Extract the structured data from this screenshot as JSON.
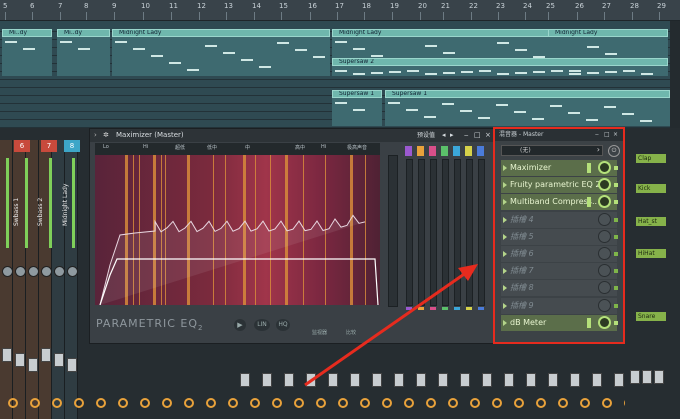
{
  "ruler": {
    "bars": [
      "5",
      "6",
      "7",
      "8",
      "9",
      "10",
      "11",
      "12",
      "13",
      "14",
      "15",
      "16",
      "17",
      "18",
      "19",
      "20",
      "21",
      "22",
      "23",
      "24",
      "25",
      "26",
      "27",
      "28",
      "29"
    ]
  },
  "playlist": {
    "clips": [
      {
        "label": "Mi..dy"
      },
      {
        "label": "Mi..dy"
      },
      {
        "label": "Midnight Lady"
      },
      {
        "label": "Midnight Lady"
      },
      {
        "label": "Midnight Lady"
      },
      {
        "label": "Supersaw 2"
      },
      {
        "label": "Supersaw 1"
      },
      {
        "label": "Supersaw 1"
      }
    ]
  },
  "mixer": {
    "channel_numbers": [
      "6",
      "7",
      "8"
    ],
    "channel_labels": [
      "Swbass 1",
      "Swbass 2",
      "Midnight Lady"
    ]
  },
  "maximizer": {
    "title": "Maximizer (Master)",
    "preset_label": "预设值",
    "eq_headers": [
      "Lo",
      "Hi",
      "超低",
      "低中",
      "中",
      "高中",
      "Hi",
      "极高声音"
    ],
    "plugin_label": "PARAMETRIC EQ",
    "plugin_sub": "2",
    "bottom_buttons": [
      "LIN",
      "HQ",
      "监视器",
      "比较"
    ],
    "colors": {
      "bands": [
        "#9b59d0",
        "#e9a23b",
        "#d94f8a",
        "#5bc06a",
        "#3ba7d9",
        "#d6d24a",
        "#4a7bd9"
      ]
    }
  },
  "rack": {
    "title": "混音器 - Master",
    "select_value": "(无)",
    "slots": [
      {
        "name": "Maximizer",
        "active": true
      },
      {
        "name": "Fruity parametric EQ 2",
        "active": true
      },
      {
        "name": "Multiband Compress..",
        "active": true
      },
      {
        "name": "插槽 4",
        "active": false
      },
      {
        "name": "插槽 5",
        "active": false
      },
      {
        "name": "插槽 6",
        "active": false
      },
      {
        "name": "插槽 7",
        "active": false
      },
      {
        "name": "插槽 8",
        "active": false
      },
      {
        "name": "插槽 9",
        "active": false
      },
      {
        "name": "dB Meter",
        "active": true
      }
    ]
  },
  "right_labels": [
    "Clap",
    "Kick",
    "Hat_st",
    "HiHat",
    "Snare"
  ]
}
